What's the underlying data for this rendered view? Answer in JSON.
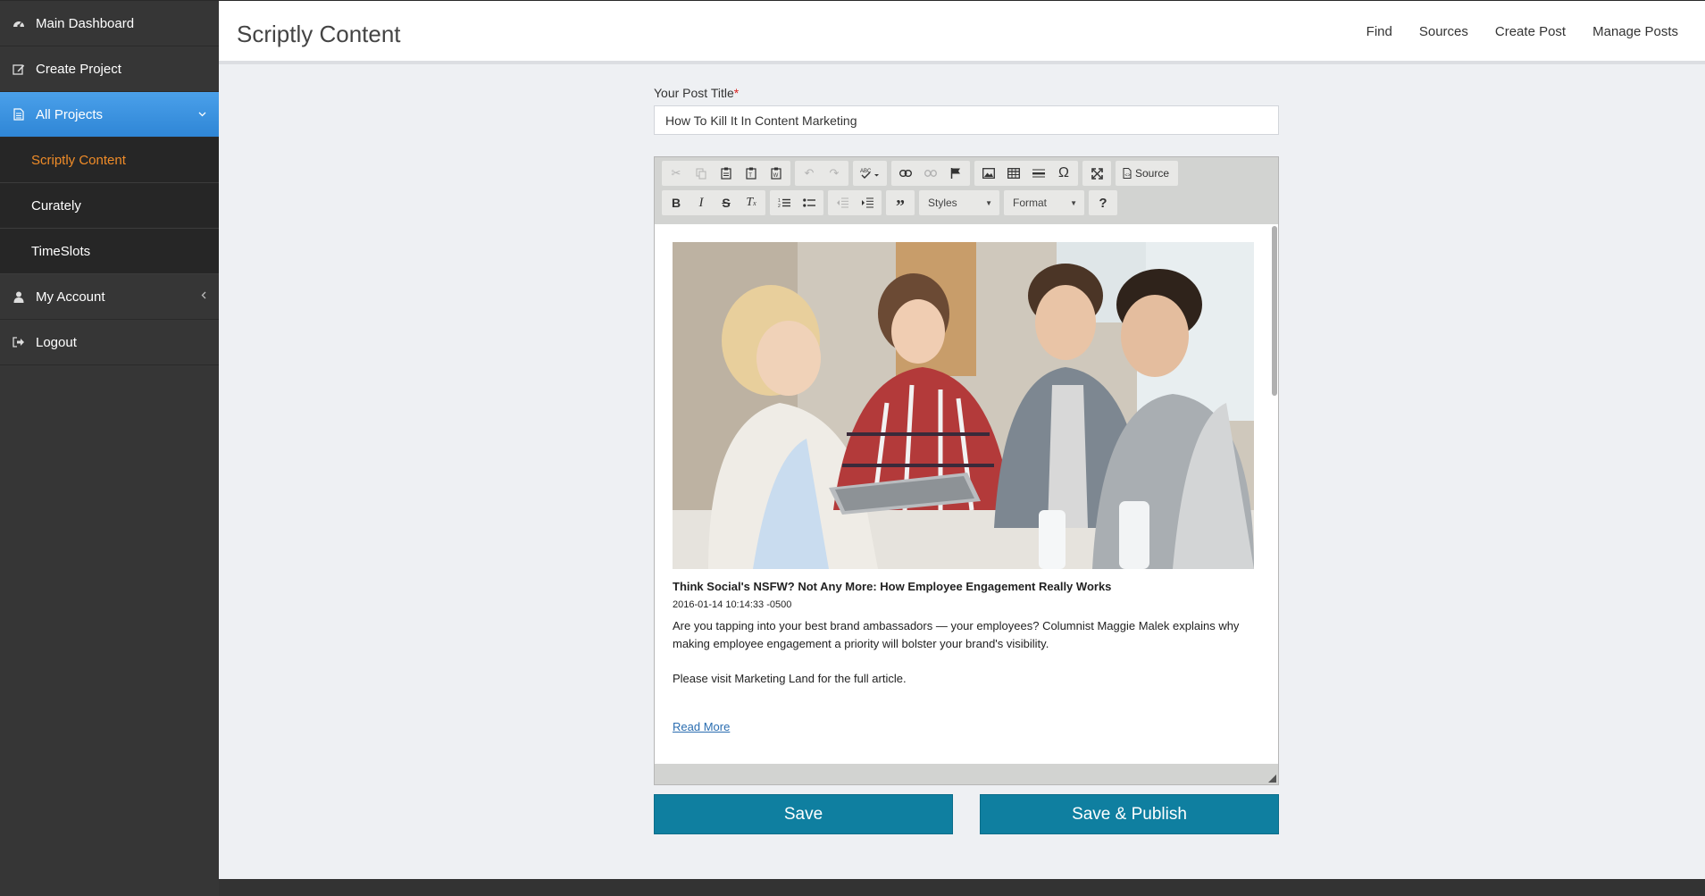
{
  "sidebar": {
    "items": [
      {
        "label": "Main Dashboard",
        "icon": "dashboard-icon"
      },
      {
        "label": "Create Project",
        "icon": "edit-icon"
      },
      {
        "label": "All Projects",
        "icon": "document-icon",
        "caret": "chevron-down-icon"
      }
    ],
    "subitems": [
      {
        "label": "Scriptly Content"
      },
      {
        "label": "Curately"
      },
      {
        "label": "TimeSlots"
      }
    ],
    "bottom_items": [
      {
        "label": "My Account",
        "icon": "user-icon",
        "caret": "chevron-left-icon"
      },
      {
        "label": "Logout",
        "icon": "logout-icon"
      }
    ]
  },
  "header": {
    "title": "Scriptly Content",
    "nav": [
      "Find",
      "Sources",
      "Create Post",
      "Manage Posts"
    ]
  },
  "form": {
    "title_label": "Your Post Title",
    "required_mark": "*",
    "title_value": "How To Kill It In Content Marketing"
  },
  "editor": {
    "toolbar": {
      "styles_label": "Styles",
      "format_label": "Format",
      "source_label": "Source"
    },
    "article": {
      "title": "Think Social's NSFW? Not Any More: How Employee Engagement Really Works",
      "date": "2016-01-14 10:14:33 -0500",
      "body": "Are you tapping into your best brand ambassadors — your employees? Columnist Maggie Malek explains why making employee engagement a priority will bolster your brand's visibility.",
      "visit": "Please visit Marketing Land for the full article.",
      "link": "Read More"
    }
  },
  "buttons": {
    "save": "Save",
    "save_publish": "Save & Publish"
  },
  "colors": {
    "sidebar_bg": "#363636",
    "active_item": "#3b8fdd",
    "current_subitem": "#f08c28",
    "button": "#0f7fa0"
  }
}
